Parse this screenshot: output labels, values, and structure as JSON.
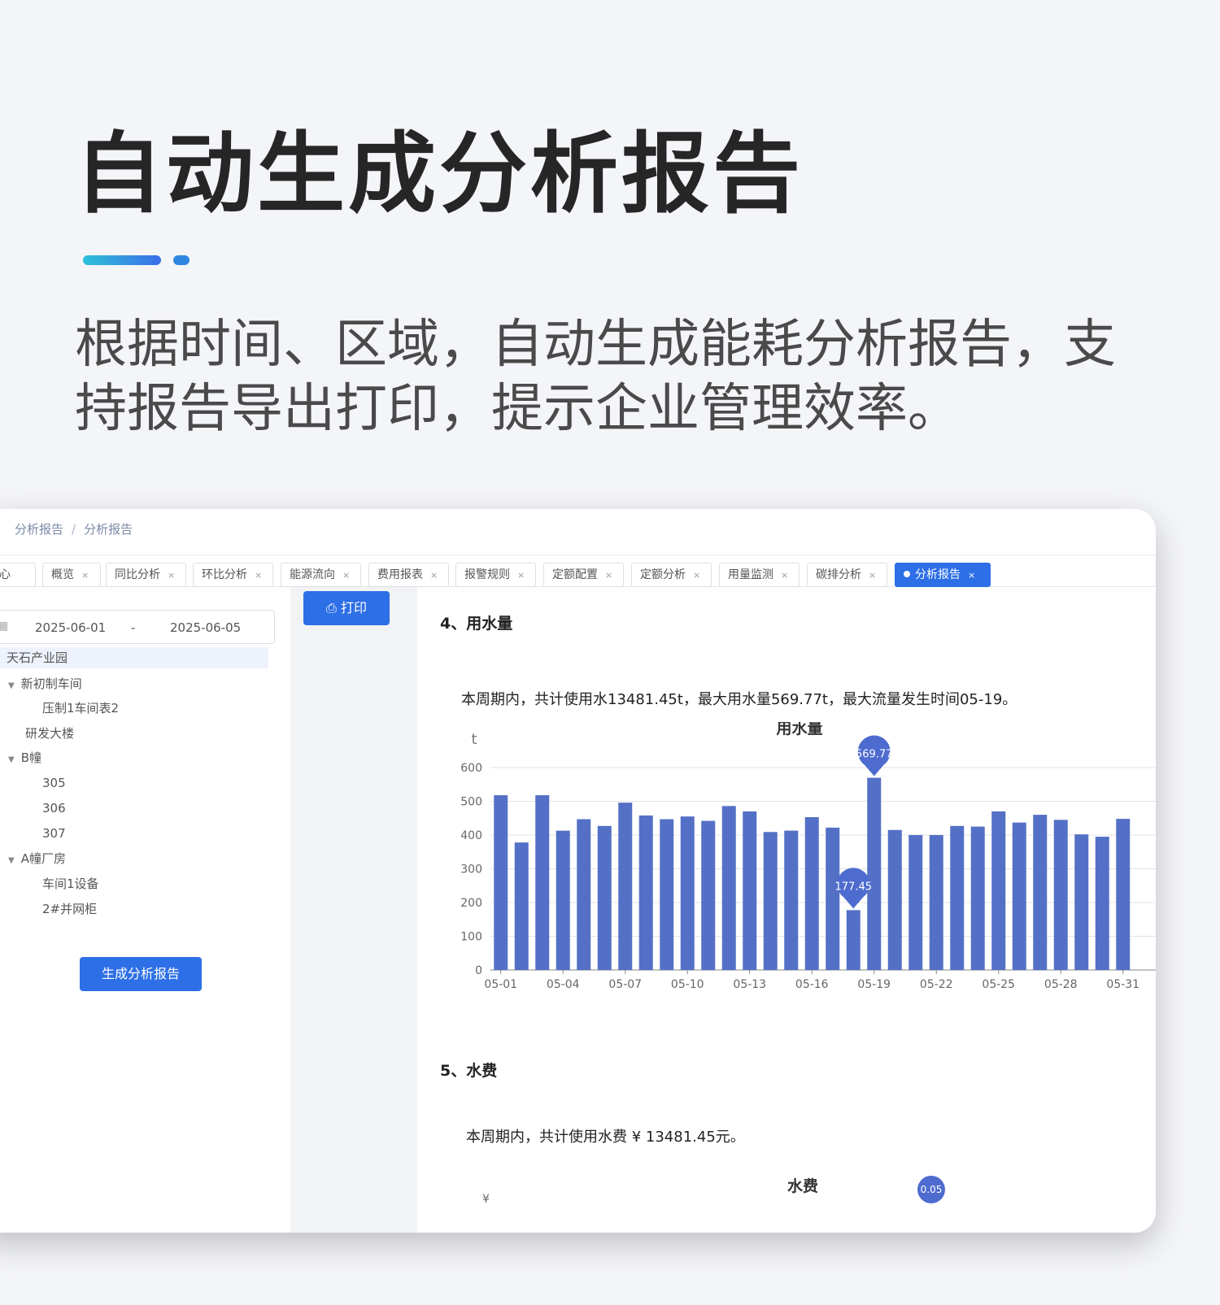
{
  "hero": {
    "title": "自动生成分析报告",
    "description": "根据时间、区域，自动生成能耗分析报告，支持报告导出打印，提示企业管理效率。"
  },
  "breadcrumb": [
    "分析报告",
    "分析报告"
  ],
  "tabs": [
    {
      "label": "人中心"
    },
    {
      "label": "概览"
    },
    {
      "label": "同比分析"
    },
    {
      "label": "环比分析"
    },
    {
      "label": "能源流向"
    },
    {
      "label": "费用报表"
    },
    {
      "label": "报警规则"
    },
    {
      "label": "定额配置"
    },
    {
      "label": "定额分析"
    },
    {
      "label": "用量监测"
    },
    {
      "label": "碳排分析"
    },
    {
      "label": "分析报告",
      "active": true
    }
  ],
  "tab_close": "×",
  "date_range": {
    "start": "2025-06-01",
    "separator": "-",
    "end": "2025-06-05"
  },
  "tree": [
    {
      "label": "天石产业园"
    },
    {
      "label": "新初制车间"
    },
    {
      "label": "压制1车间表2"
    },
    {
      "label": "研发大楼"
    },
    {
      "label": "B幢"
    },
    {
      "label": "305"
    },
    {
      "label": "306"
    },
    {
      "label": "307"
    },
    {
      "label": "A幢厂房"
    },
    {
      "label": "车间1设备"
    },
    {
      "label": "2#并网柜"
    }
  ],
  "buttons": {
    "generate": "生成分析报告",
    "print": "打印"
  },
  "report": {
    "section4_title": "4、用水量",
    "section4_text": "本周期内，共计使用水13481.45t，最大用水量569.77t，最大流量发生时间05-19。",
    "section5_title": "5、水费",
    "section5_text": "本周期内，共计使用水费 ¥ 13481.45元。",
    "chart2_title": "水费",
    "chart2_unit": "¥",
    "chart2_marker": "0.05"
  },
  "colors": {
    "primary": "#2d6fe6",
    "bar": "#5470c6"
  },
  "chart_data": {
    "type": "bar",
    "title": "用水量",
    "ylabel": "t",
    "ylim": [
      0,
      600
    ],
    "yticks": [
      0,
      100,
      200,
      300,
      400,
      500,
      600
    ],
    "categories": [
      "05-01",
      "05-02",
      "05-03",
      "05-04",
      "05-05",
      "05-06",
      "05-07",
      "05-08",
      "05-09",
      "05-10",
      "05-11",
      "05-12",
      "05-13",
      "05-14",
      "05-15",
      "05-16",
      "05-17",
      "05-18",
      "05-19",
      "05-20",
      "05-21",
      "05-22",
      "05-23",
      "05-24",
      "05-25",
      "05-26",
      "05-27",
      "05-28",
      "05-29",
      "05-30",
      "05-31"
    ],
    "xtick_labels": [
      "05-01",
      "05-04",
      "05-07",
      "05-10",
      "05-13",
      "05-16",
      "05-19",
      "05-22",
      "05-25",
      "05-28",
      "05-31"
    ],
    "values": [
      518,
      378,
      518,
      413,
      447,
      427,
      496,
      458,
      447,
      455,
      442,
      486,
      470,
      409,
      413,
      453,
      422,
      177.45,
      569.77,
      415,
      400,
      400,
      427,
      425,
      470,
      437,
      460,
      445,
      402,
      395,
      448
    ],
    "markers": [
      {
        "category": "05-19",
        "label": "569.77"
      },
      {
        "category": "05-18",
        "label": "177.45"
      }
    ]
  }
}
